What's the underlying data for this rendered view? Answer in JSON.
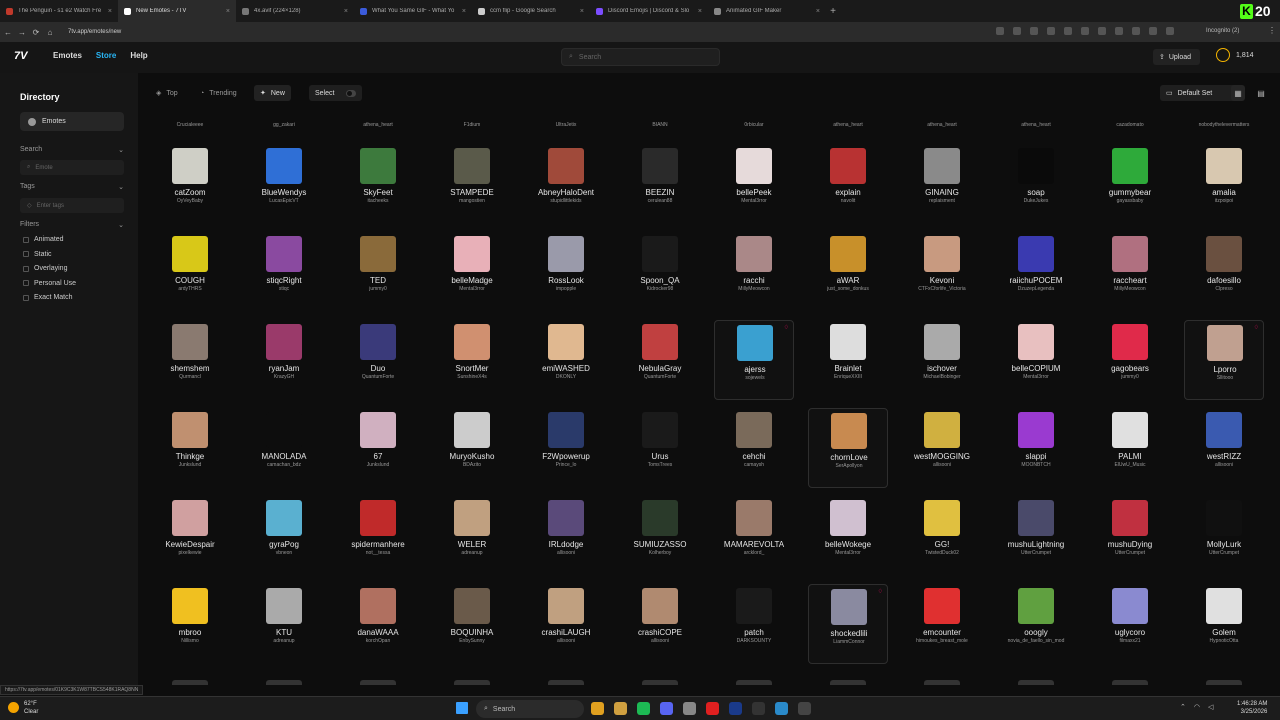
{
  "browser": {
    "tabs": [
      {
        "title": "The Penguin - s1 e2 Watch Fre",
        "color": "#c0392b"
      },
      {
        "title": "New Emotes - 7TV",
        "color": "#ffffff",
        "active": true
      },
      {
        "title": "4x.avif (224×128)",
        "color": "#777777"
      },
      {
        "title": "What You Same GIF - What Yo",
        "color": "#3b5bdb"
      },
      {
        "title": "ccm flip - Google Search",
        "color": "#cccccc"
      },
      {
        "title": "Discord Emojis | Discord & Slo",
        "color": "#7c4dff"
      },
      {
        "title": "Animated GIF Maker",
        "color": "#888888"
      }
    ],
    "new_tab": "+",
    "kick_count": "20",
    "url": "7tv.app/emotes/new",
    "incognito": "Incognito (2)"
  },
  "site": {
    "logo": "7V",
    "nav": {
      "emotes": "Emotes",
      "store": "Store",
      "help": "Help"
    },
    "search_placeholder": "Search",
    "upload": "Upload",
    "coins": "1,814"
  },
  "sidebar": {
    "title": "Directory",
    "emotes_btn": "Emotes",
    "search_label": "Search",
    "emote_placeholder": "Emote",
    "tags_label": "Tags",
    "tags_placeholder": "Enter tags",
    "filters_label": "Filters",
    "filters": [
      "Animated",
      "Static",
      "Overlaying",
      "Personal Use",
      "Exact Match"
    ]
  },
  "toolbar": {
    "top": "Top",
    "trending": "Trending",
    "new": "New",
    "select": "Select",
    "default_set": "Default Set"
  },
  "top_row": [
    {
      "owner": "Crucialeeee"
    },
    {
      "owner": "gg_zakari"
    },
    {
      "owner": "athena_heart"
    },
    {
      "owner": "F1dium"
    },
    {
      "owner": "UltraJetix"
    },
    {
      "owner": "BIANN"
    },
    {
      "owner": "0rbicular"
    },
    {
      "owner": "athena_heart"
    },
    {
      "owner": "athena_heart"
    },
    {
      "owner": "athena_heart"
    },
    {
      "owner": "cazadomato"
    },
    {
      "owner": "nobodythelevermatters"
    }
  ],
  "emotes": [
    {
      "name": "catZoom",
      "owner": "OyVeyBaby",
      "color": "#cfcfc6"
    },
    {
      "name": "BlueWendys",
      "owner": "LucasEpicVT",
      "color": "#2f6fd6"
    },
    {
      "name": "SkyFeet",
      "owner": "itacheeks",
      "color": "#3d7a3d"
    },
    {
      "name": "STAMPEDE",
      "owner": "mangostien",
      "color": "#5a5a4a"
    },
    {
      "name": "AbneyHaloDent",
      "owner": "stupidlittlekids",
      "color": "#a04a3a"
    },
    {
      "name": "BEEZIN",
      "owner": "cerulean88",
      "color": "#2a2a2a"
    },
    {
      "name": "bellePeek",
      "owner": "Mental3rror",
      "color": "#e6dada"
    },
    {
      "name": "explain",
      "owner": "navolit",
      "color": "#b83232"
    },
    {
      "name": "GINAING",
      "owner": "replaisment",
      "color": "#8a8a8a"
    },
    {
      "name": "soap",
      "owner": "DukeJukes",
      "color": "#0a0a0a"
    },
    {
      "name": "gummybear",
      "owner": "gayassbaby",
      "color": "#2eaa3a"
    },
    {
      "name": "amalia",
      "owner": "itzpoipoi",
      "color": "#d8c8b0"
    },
    {
      "name": "COUGH",
      "owner": "ardyTHRS",
      "color": "#d8c818"
    },
    {
      "name": "stiqcRight",
      "owner": "stiqc",
      "color": "#8a4aa0"
    },
    {
      "name": "TED",
      "owner": "jummy0",
      "color": "#8a6a3a"
    },
    {
      "name": "belleMadge",
      "owner": "Mental3rror",
      "color": "#e8b0b8"
    },
    {
      "name": "RossLook",
      "owner": "impopple",
      "color": "#9a9aaa"
    },
    {
      "name": "Spoon_QA",
      "owner": "Kidrocker98",
      "color": "#1a1a1a"
    },
    {
      "name": "racchi",
      "owner": "MillyMeowcon",
      "color": "#aa8888"
    },
    {
      "name": "aWAR",
      "owner": "just_some_donkus",
      "color": "#c8902a"
    },
    {
      "name": "Kevoni",
      "owner": "CTFxCforlife_Victoria",
      "color": "#c89a80"
    },
    {
      "name": "raiichuPOCEM",
      "owner": "DzuzepLegenda",
      "color": "#3a3ab0"
    },
    {
      "name": "raccheart",
      "owner": "MillyMeowcon",
      "color": "#b07080"
    },
    {
      "name": "dafoesillo",
      "owner": "Clpreso",
      "color": "#6a5040"
    },
    {
      "name": "shemshem",
      "owner": "Qurmancl",
      "color": "#8a7a70"
    },
    {
      "name": "ryanJam",
      "owner": "KrazyGH",
      "color": "#9a3a6a"
    },
    {
      "name": "Duo",
      "owner": "QuantumForte",
      "color": "#3a3a7a"
    },
    {
      "name": "SnortMer",
      "owner": "SunshineX4s",
      "color": "#d09070"
    },
    {
      "name": "emiWASHED",
      "owner": "DKONLY",
      "color": "#e0b890"
    },
    {
      "name": "NebulaGray",
      "owner": "QuantumForte",
      "color": "#c04040"
    },
    {
      "name": "ajerss",
      "owner": "sojewels",
      "color": "#3aa0d0"
    },
    {
      "name": "Brainlet",
      "owner": "EnriqueXXIII",
      "color": "#dddddd"
    },
    {
      "name": "ischover",
      "owner": "MichaelBobinger",
      "color": "#aaaaaa"
    },
    {
      "name": "belleCOPIUM",
      "owner": "Mental3rror",
      "color": "#e8c0c0"
    },
    {
      "name": "gagobears",
      "owner": "jummy0",
      "color": "#e02a4a"
    },
    {
      "name": "Lporro",
      "owner": "Sllitooo",
      "color": "#c0a090"
    },
    {
      "name": "Thinkge",
      "owner": "Junkslund",
      "color": "#c09070"
    },
    {
      "name": "MANOLADA",
      "owner": "camachan_bdz",
      "color": "#0d0d0d"
    },
    {
      "name": "67",
      "owner": "Junkslund",
      "color": "#d0b0c0"
    },
    {
      "name": "MuryoKusho",
      "owner": "BDAzito",
      "color": "#cccccc"
    },
    {
      "name": "F2Wpowerup",
      "owner": "Prince_lo",
      "color": "#2a3a6a"
    },
    {
      "name": "Urus",
      "owner": "TomsTrees",
      "color": "#1a1a1a"
    },
    {
      "name": "cehchi",
      "owner": "camaysh",
      "color": "#7a6a5a"
    },
    {
      "name": "chornLove",
      "owner": "SerApollyon",
      "color": "#c88a50"
    },
    {
      "name": "westMOGGING",
      "owner": "allisooni",
      "color": "#d0b040"
    },
    {
      "name": "slappi",
      "owner": "MOONBTCH",
      "color": "#9a3ad0"
    },
    {
      "name": "PALMI",
      "owner": "ElUwU_Music",
      "color": "#e0e0e0"
    },
    {
      "name": "westRIZZ",
      "owner": "allisooni",
      "color": "#3a5ab0"
    },
    {
      "name": "KewieDespair",
      "owner": "pixelkewie",
      "color": "#d0a0a0"
    },
    {
      "name": "gyraPog",
      "owner": "vbneon",
      "color": "#5ab0d0"
    },
    {
      "name": "spidermanhere",
      "owner": "not__tessa",
      "color": "#c02a2a"
    },
    {
      "name": "WELER",
      "owner": "adreanup",
      "color": "#c0a080"
    },
    {
      "name": "IRLdodge",
      "owner": "allisooni",
      "color": "#5a4a7a"
    },
    {
      "name": "SUMIUZASSO",
      "owner": "Kolherboy",
      "color": "#2a3a2a"
    },
    {
      "name": "MAMAREVOLTA",
      "owner": "arcklord_",
      "color": "#9a7a6a"
    },
    {
      "name": "belleWokege",
      "owner": "Mental3rror",
      "color": "#d0c0d0"
    },
    {
      "name": "GG!",
      "owner": "TwistedDuck02",
      "color": "#e0c040"
    },
    {
      "name": "mushuLightning",
      "owner": "UtterCrumpet",
      "color": "#4a4a6a"
    },
    {
      "name": "mushuDying",
      "owner": "UtterCrumpet",
      "color": "#c03040"
    },
    {
      "name": "MollyLurk",
      "owner": "UtterCrumpet",
      "color": "#101010"
    },
    {
      "name": "mbroo",
      "owner": "Nillismo",
      "color": "#f0c020"
    },
    {
      "name": "KTU",
      "owner": "adreanup",
      "color": "#aaaaaa"
    },
    {
      "name": "danaWAAA",
      "owner": "korchOpan",
      "color": "#b07060"
    },
    {
      "name": "BOQUINHA",
      "owner": "EnbySunny",
      "color": "#6a5a4a"
    },
    {
      "name": "crashiLAUGH",
      "owner": "allisooni",
      "color": "#c0a080"
    },
    {
      "name": "crashiCOPE",
      "owner": "allisooni",
      "color": "#b08a70"
    },
    {
      "name": "patch",
      "owner": "DARKSOUNTY",
      "color": "#1a1a1a"
    },
    {
      "name": "shockedlili",
      "owner": "LiammConnor",
      "color": "#8a8aa0"
    },
    {
      "name": "emcounter",
      "owner": "himoukes_breast_mole",
      "color": "#e03030"
    },
    {
      "name": "ooogly",
      "owner": "novia_de_faello_sin_mod",
      "color": "#60a040"
    },
    {
      "name": "uglycoro",
      "owner": "filmaxx21",
      "color": "#8a8ad0"
    },
    {
      "name": "Golem",
      "owner": "HypnoticOtta",
      "color": "#e0e0e0"
    }
  ],
  "highlighted": [
    "ajerss",
    "Lporro",
    "shockedlili",
    "chornLove"
  ],
  "hearts": [
    "ajerss",
    "Lporro",
    "shockedlili"
  ],
  "status_url": "https://7tv.app/emotes/01K9C3K1W87TBCS548K1RAQ8NN",
  "taskbar": {
    "temp": "62°F",
    "weather": "Clear",
    "search": "Search",
    "time": "1:46:28 AM",
    "date": "3/25/2026"
  }
}
